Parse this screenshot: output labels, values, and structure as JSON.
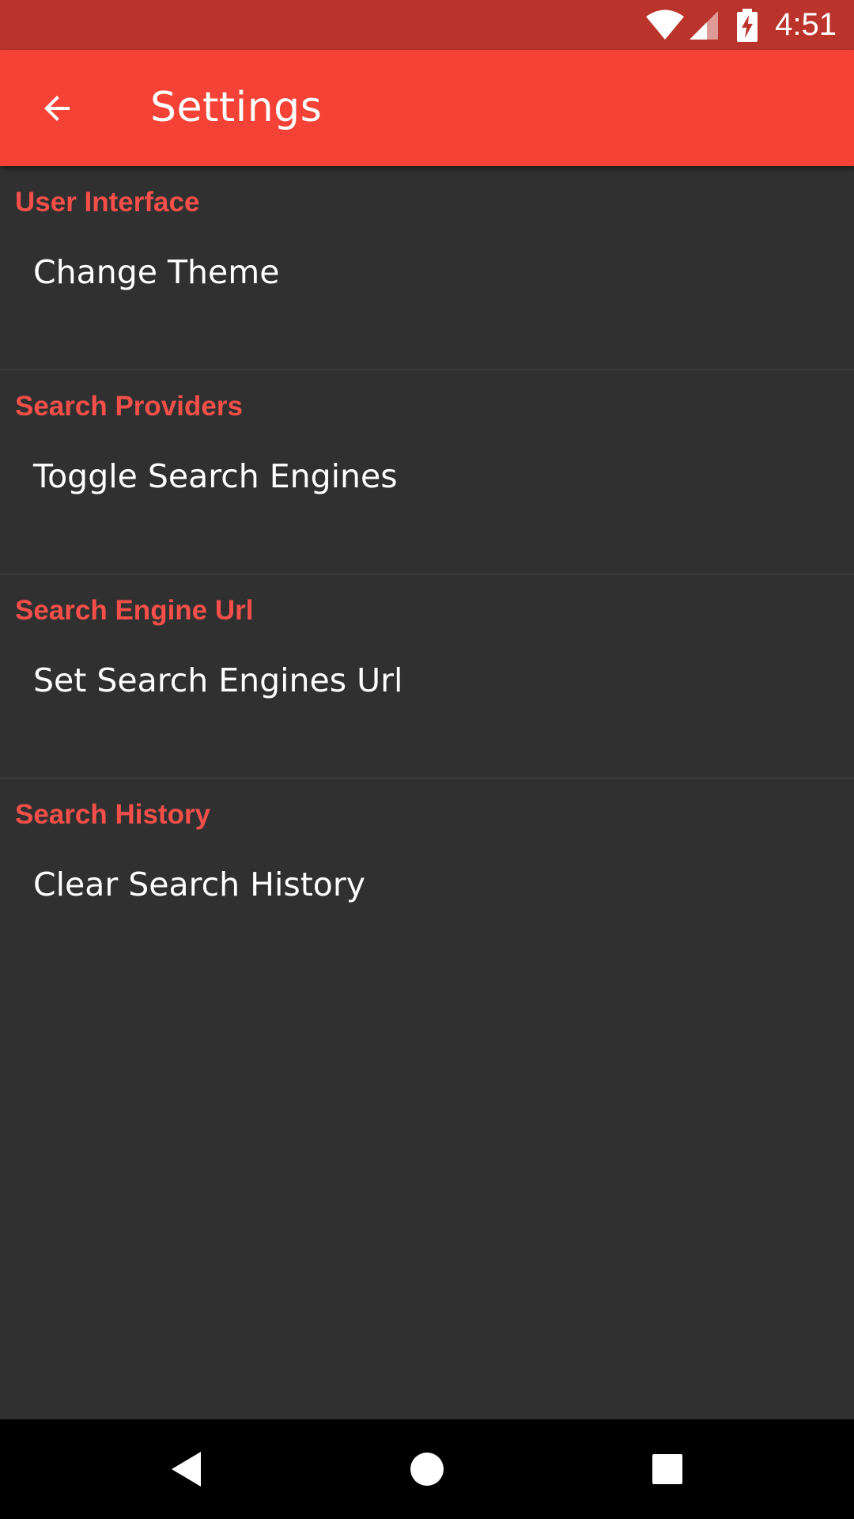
{
  "status_bar": {
    "time": "4:51",
    "icons": [
      "wifi-icon",
      "signal-icon",
      "battery-charging-icon"
    ],
    "background": "#BA342C"
  },
  "app_bar": {
    "title": "Settings",
    "back_icon": "arrow-back-icon",
    "background": "#F44336"
  },
  "sections": [
    {
      "header": "User Interface",
      "item": "Change Theme"
    },
    {
      "header": "Search Providers",
      "item": "Toggle Search Engines"
    },
    {
      "header": "Search Engine Url",
      "item": "Set Search Engines Url"
    },
    {
      "header": "Search History",
      "item": "Clear Search History"
    }
  ],
  "nav_bar": {
    "icons": [
      "nav-back-icon",
      "nav-home-icon",
      "nav-recents-icon"
    ]
  },
  "colors": {
    "accent": "#F44F48",
    "background": "#303030",
    "text": "#FFFFFF"
  }
}
